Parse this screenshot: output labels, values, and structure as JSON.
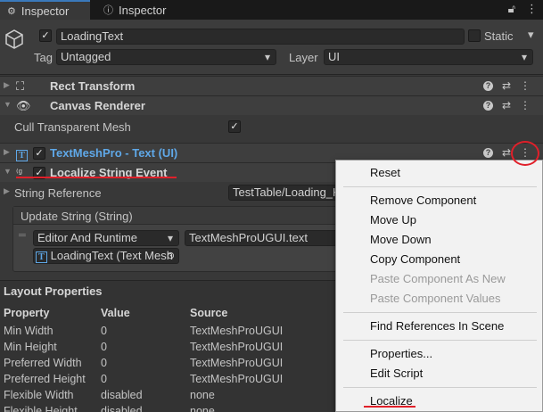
{
  "tabs": [
    {
      "icon": "gear-icon",
      "label": "Inspector"
    },
    {
      "icon": "info-icon",
      "label": "Inspector"
    }
  ],
  "tab_icons_right": [
    "lock-icon",
    "more-icon"
  ],
  "gameobject": {
    "name": "LoadingText",
    "active": true,
    "static_label": "Static",
    "tag_label": "Tag",
    "tag_value": "Untagged",
    "layer_label": "Layer",
    "layer_value": "UI"
  },
  "components": [
    {
      "name": "Rect Transform",
      "icon": "rect-transform-icon"
    },
    {
      "name": "Canvas Renderer",
      "icon": "eye-icon"
    },
    {
      "name": "TextMeshPro - Text (UI)",
      "icon": "textmeshpro-icon",
      "enabled": true
    },
    {
      "name": "Localize String Event",
      "icon": "localize-icon",
      "enabled": true
    }
  ],
  "canvas_renderer": {
    "cull_label": "Cull Transparent Mesh",
    "cull_value": true
  },
  "localize": {
    "string_reference_label": "String Reference",
    "string_reference_value": "TestTable/Loading_K",
    "update_string_label": "Update String (String)",
    "runtime_option": "Editor And Runtime",
    "method": "TextMeshProUGUI.text",
    "target": "LoadingText (Text Mesh"
  },
  "layout_properties": {
    "title": "Layout Properties",
    "headers": [
      "Property",
      "Value",
      "Source"
    ],
    "rows": [
      [
        "Min Width",
        "0",
        "TextMeshProUGUI"
      ],
      [
        "Min Height",
        "0",
        "TextMeshProUGUI"
      ],
      [
        "Preferred Width",
        "0",
        "TextMeshProUGUI"
      ],
      [
        "Preferred Height",
        "0",
        "TextMeshProUGUI"
      ],
      [
        "Flexible Width",
        "disabled",
        "none"
      ],
      [
        "Flexible Height",
        "disabled",
        "none"
      ]
    ]
  },
  "context_menu": {
    "items": [
      {
        "label": "Reset",
        "enabled": true
      },
      {
        "label": "Remove Component",
        "enabled": true
      },
      {
        "label": "Move Up",
        "enabled": true
      },
      {
        "label": "Move Down",
        "enabled": true
      },
      {
        "label": "Copy Component",
        "enabled": true
      },
      {
        "label": "Paste Component As New",
        "enabled": false
      },
      {
        "label": "Paste Component Values",
        "enabled": false
      },
      {
        "label": "Find References In Scene",
        "enabled": true
      },
      {
        "label": "Properties...",
        "enabled": true
      },
      {
        "label": "Edit Script",
        "enabled": true
      },
      {
        "label": "Localize",
        "enabled": true
      }
    ]
  },
  "colors": {
    "background": "#383838",
    "accent_blue": "#5fa8e8",
    "annotation_red": "#e0202a",
    "menu_bg": "#f2f2f2"
  }
}
